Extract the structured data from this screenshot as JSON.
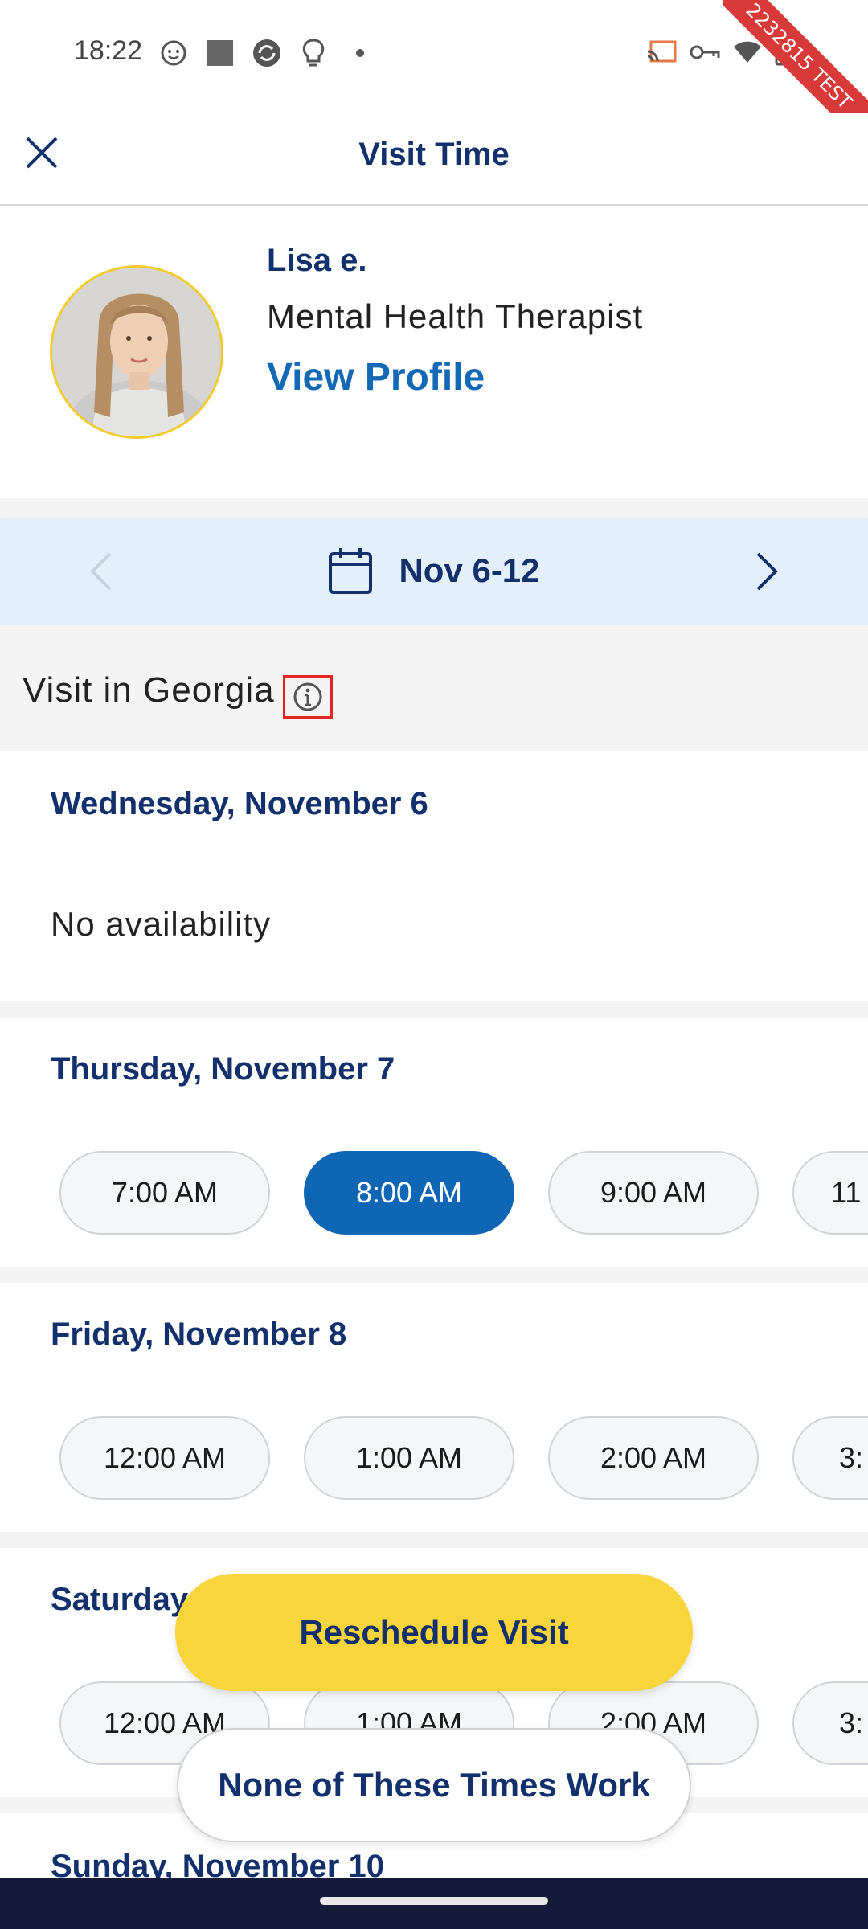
{
  "status_bar": {
    "time": "18:22",
    "test_ribbon": "2232815 TEST"
  },
  "app_bar": {
    "title": "Visit Time",
    "close_icon": "close-icon"
  },
  "provider": {
    "name": "Lisa e.",
    "role": "Mental Health Therapist",
    "profile_link": "View Profile"
  },
  "week_nav": {
    "label": "Nov 6-12",
    "prev_icon": "chevron-left-icon",
    "next_icon": "chevron-right-icon",
    "calendar_icon": "calendar-icon"
  },
  "location": {
    "text": "Visit in Georgia",
    "info_icon": "info-icon"
  },
  "days": [
    {
      "title": "Wednesday, November 6",
      "no_availability": "No availability",
      "slots": []
    },
    {
      "title": "Thursday, November 7",
      "slots": [
        "7:00 AM",
        "8:00 AM",
        "9:00 AM",
        "11"
      ],
      "selected": "8:00 AM"
    },
    {
      "title": "Friday, November 8",
      "slots": [
        "12:00 AM",
        "1:00 AM",
        "2:00 AM",
        "3:"
      ]
    },
    {
      "title": "Saturday",
      "slots": [
        "12:00 AM",
        "1:00 AM",
        "2:00 AM",
        "3:"
      ]
    },
    {
      "title": "Sunday, November 10",
      "slots": []
    }
  ],
  "actions": {
    "reschedule": "Reschedule Visit",
    "none_work": "None of These Times Work"
  },
  "colors": {
    "primary": "#0f66b4",
    "navy": "#12306b",
    "accent": "#f8d53a",
    "nav_bg": "#e3eff9"
  }
}
